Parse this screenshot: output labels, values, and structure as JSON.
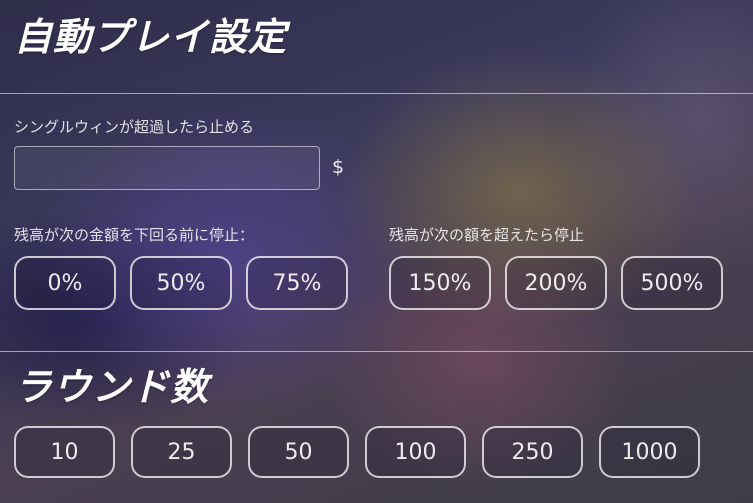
{
  "header": {
    "title": "自動プレイ設定"
  },
  "single_win": {
    "label": "シングルウィンが超過したら止める",
    "value": "",
    "currency": "$"
  },
  "balance_below": {
    "label": "残高が次の金額を下回る前に停止：",
    "options": [
      "0%",
      "50%",
      "75%"
    ]
  },
  "balance_above": {
    "label": "残高が次の額を超えたら停止",
    "options": [
      "150%",
      "200%",
      "500%"
    ]
  },
  "rounds": {
    "title": "ラウンド数",
    "options": [
      "10",
      "25",
      "50",
      "100",
      "250",
      "1000"
    ]
  }
}
